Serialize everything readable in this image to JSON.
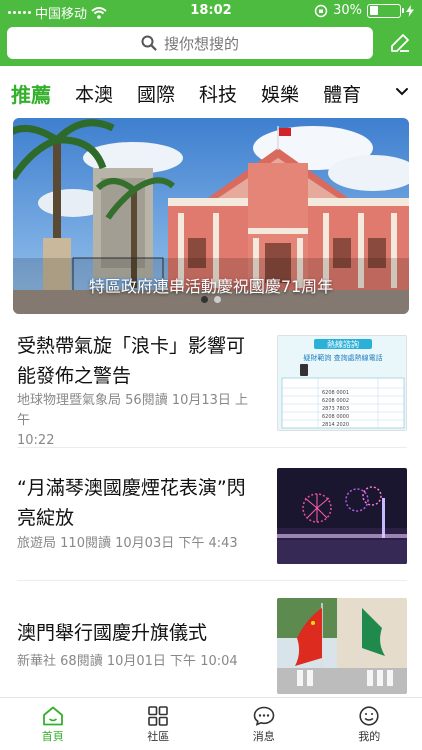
{
  "status_bar": {
    "carrier": "中国移动",
    "time": "18:02",
    "battery_text": "30%",
    "battery_level": 0.3
  },
  "search": {
    "placeholder": "搜你想搜的"
  },
  "tabs": [
    {
      "label": "推薦",
      "active": true
    },
    {
      "label": "本澳",
      "active": false
    },
    {
      "label": "國際",
      "active": false
    },
    {
      "label": "科技",
      "active": false
    },
    {
      "label": "娛樂",
      "active": false
    },
    {
      "label": "體育",
      "active": false
    }
  ],
  "banner": {
    "caption": "特區政府連串活動慶祝國慶71周年",
    "slide_count": 2,
    "active_slide": 1
  },
  "news": [
    {
      "title": "受熱帶氣旋「浪卡」影響可能發佈之警告",
      "source": "地球物理暨氣象局",
      "reads": "56閱讀",
      "date_line1": "10月13日 上午",
      "date_line2": "10:22",
      "thumb": {
        "heading": "熱線諮詢",
        "subheading": "疑財範詢 查詢處熱線電話",
        "rows": [
          "6208 0001",
          "6208 0002",
          "2873 7803",
          "6208 0000",
          "2814 2020"
        ]
      }
    },
    {
      "title": "“月滿琴澳國慶煙花表演”閃亮綻放",
      "source": "旅遊局",
      "reads": "110閱讀",
      "date": "10月03日 下午 4:43"
    },
    {
      "title": "澳門舉行國慶升旗儀式",
      "source": "新華社",
      "reads": "68閱讀",
      "date": "10月01日 下午 10:04"
    }
  ],
  "bottom_nav": [
    {
      "label": "首頁",
      "icon": "home-icon",
      "active": true
    },
    {
      "label": "社區",
      "icon": "grid-icon",
      "active": false
    },
    {
      "label": "消息",
      "icon": "chat-icon",
      "active": false
    },
    {
      "label": "我的",
      "icon": "smile-icon",
      "active": false
    }
  ],
  "colors": {
    "brand_green": "#4dbb3f",
    "active_green": "#35b02c"
  }
}
